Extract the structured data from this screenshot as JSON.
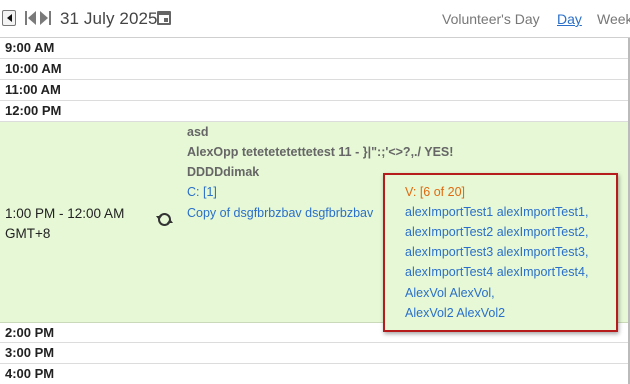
{
  "toolbar": {
    "date_title": "31 July 2025",
    "volunteers_day": "Volunteer's Day",
    "day_label": "Day",
    "week_label": "Week"
  },
  "icons": {
    "collapse": "collapse-left-icon",
    "prev": "previous-icon",
    "next": "next-icon",
    "calendar": "calendar-icon",
    "recurring": "recurring-icon"
  },
  "slots": {
    "t9": "9:00 AM",
    "t10": "10:00 AM",
    "t11": "11:00 AM",
    "t12": "12:00 PM",
    "t2": "2:00 PM",
    "t3": "3:00 PM",
    "t4": "4:00 PM"
  },
  "event_slot": {
    "time_range": "1:00 PM - 12:00 AM",
    "timezone": "GMT+8",
    "lines": [
      "asd",
      "AlexOpp tetetetetettetest 11 - }|\":;'<>?,./ YES!",
      "DDDDdimak",
      "C: [1]",
      "Copy of dsgfbrbzbav dsgfbrbzbav"
    ]
  },
  "volunteer_popup": {
    "count": "V: [6 of 20]",
    "names": [
      "alexImportTest1 alexImportTest1,",
      "alexImportTest2 alexImportTest2,",
      "alexImportTest3 alexImportTest3,",
      "alexImportTest4 alexImportTest4,",
      "AlexVol AlexVol,",
      "AlexVol2 AlexVol2"
    ]
  },
  "colors": {
    "event_bg": "#e6f8d6",
    "link": "#2a6fc9",
    "popup_border": "#b71c1c",
    "count_text": "#e06a10"
  }
}
